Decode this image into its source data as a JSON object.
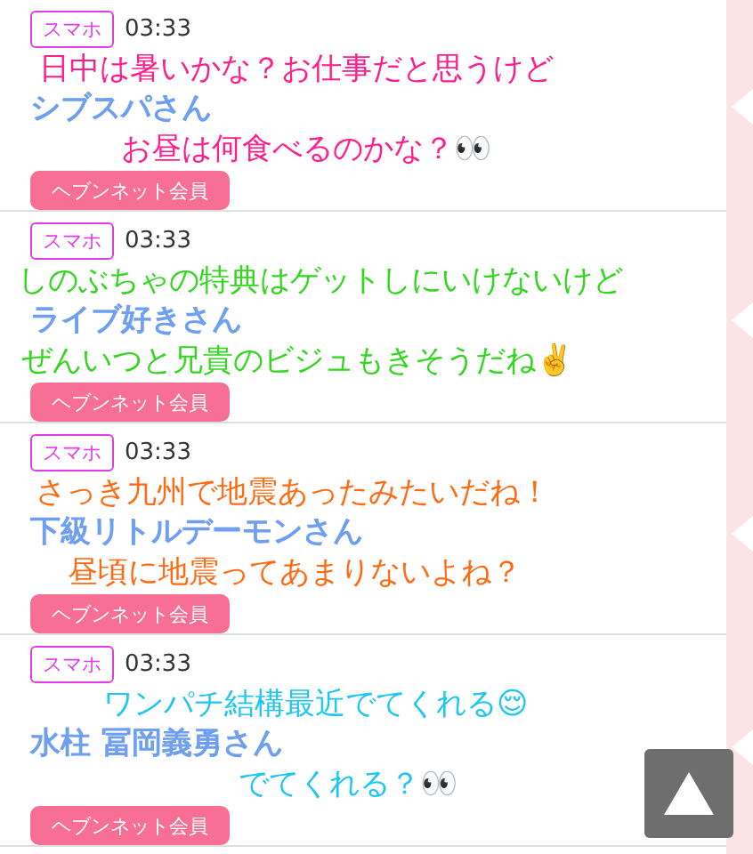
{
  "posts": [
    {
      "device": "スマホ",
      "time": "03:33",
      "name": "シブスパさん",
      "member_label": "ヘブンネット会員",
      "caption": {
        "color": "#ff1e8c",
        "lines": [
          "日中は暑いかな？お仕事だと思うけど",
          "お昼は何食べるのかな？👀"
        ]
      }
    },
    {
      "device": "スマホ",
      "time": "03:33",
      "name": "ライブ好きさん",
      "member_label": "ヘブンネット会員",
      "caption": {
        "color": "#33d61f",
        "lines": [
          "しのぶちゃの特典はゲットしにいけないけど",
          "ぜんいつと兄貴のビジュもきそうだね✌️"
        ]
      }
    },
    {
      "device": "スマホ",
      "time": "03:33",
      "name": "下級リトルデーモンさん",
      "member_label": "ヘブンネット会員",
      "caption": {
        "color": "#ff6a12",
        "lines": [
          "さっき九州で地震あったみたいだね！",
          "昼頃に地震ってあまりないよね？"
        ]
      }
    },
    {
      "device": "スマホ",
      "time": "03:33",
      "name": "水柱 冨岡義勇さん",
      "member_label": "ヘブンネット会員",
      "caption": {
        "color": "#1ec6f2",
        "lines": [
          "ワンパチ結構最近でてくれる😌",
          "でてくれる？👀"
        ]
      }
    }
  ]
}
